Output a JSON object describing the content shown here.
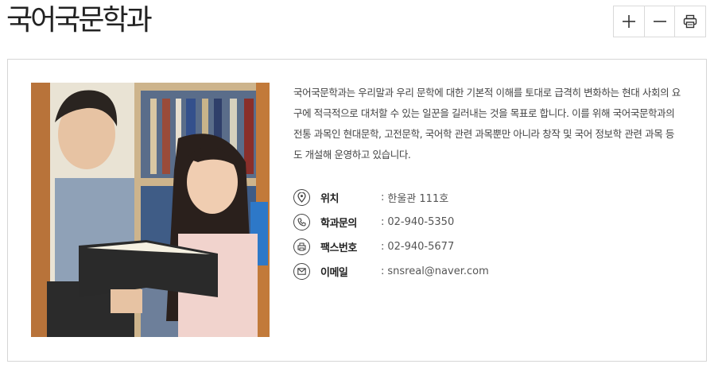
{
  "page": {
    "title": "국어국문학과"
  },
  "toolbar": {
    "zoom_in_icon": "plus-icon",
    "zoom_out_icon": "minus-icon",
    "print_icon": "printer-icon"
  },
  "department": {
    "photo_alt": "학생 사진",
    "description": "국어국문학과는 우리말과 우리 문학에 대한 기본적 이해를 토대로 급격히 변화하는 현대 사회의 요구에 적극적으로 대처할 수 있는 일꾼을 길러내는 것을 목표로 합니다. 이를 위해 국어국문학과의 전통 과목인 현대문학, 고전문학, 국어학 관련 과목뿐만 아니라 창작 및 국어 정보학 관련 과목 등도 개설해 운영하고 있습니다.",
    "info": [
      {
        "icon": "location-pin-icon",
        "label": "위치",
        "separator": ":",
        "value": "한울관 111호"
      },
      {
        "icon": "phone-icon",
        "label": "학과문의",
        "separator": ":",
        "value": "02-940-5350"
      },
      {
        "icon": "fax-icon",
        "label": "팩스번호",
        "separator": ":",
        "value": "02-940-5677"
      },
      {
        "icon": "envelope-icon",
        "label": "이메일",
        "separator": ":",
        "value": "snsreal@naver.com"
      }
    ]
  }
}
